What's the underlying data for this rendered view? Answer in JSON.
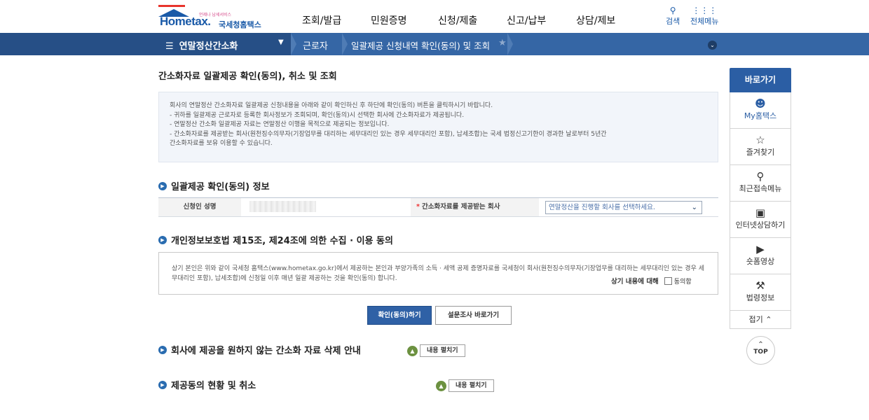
{
  "header": {
    "logo_small": "언제나 납세서비스",
    "logo_brand": "Hometax.",
    "logo_korean": "국세청홈택스",
    "nav": [
      "조회/발급",
      "민원증명",
      "신청/제출",
      "신고/납부",
      "상담/제보"
    ],
    "search_label": "검색",
    "menu_label": "전체메뉴"
  },
  "locbar": {
    "main_menu": "연말정산간소화",
    "crumb1": "근로자",
    "crumb2": "일괄제공 신청내역 확인(동의) 및 조회"
  },
  "page": {
    "title": "간소화자료 일괄제공 확인(동의), 취소 및 조회",
    "info_lines": [
      "회사의 연말정산 간소화자료 일괄제공 신청내용을 아래와 같이 확인하신 후 하단에 확인(동의) 버튼을 클릭하시기 바랍니다.",
      "- 귀하를 일괄제공 근로자로 등록한 회사정보가 조회되며, 확인(동의)시 선택한 회사에 간소화자료가 제공됩니다.",
      "- 연말정산 간소화 일괄제공 자료는 연말정산 이행을 목적으로 제공되는 정보입니다.",
      "- 간소화자료를 제공받는 회사(원천징수의무자(기장업무를 대리하는 세무대리인 있는 경우 세무대리인 포함), 납세조합)는 국세 법정신고기한이 경과한 날로부터 5년간",
      "  간소화자료를 보유 이용할 수 있습니다."
    ],
    "section1_title": "일괄제공 확인(동의) 정보",
    "applicant_label": "신청인 성명",
    "company_label": "간소화자료를 제공받는 회사",
    "company_select": "연말정산을 진행할 회사를 선택하세요.",
    "section2_title": "개인정보보호법 제15조, 제24조에 의한 수집 · 이용 동의",
    "consent_text": "상기 본인은 위와 같이 국세청 홈택스(www.hometax.go.kr)에서 제공하는 본인과 부양가족의 소득 · 세액 공제 증명자료를 국세청이 회사(원천징수의무자(기장업무를 대리하는 세무대리인 있는 경우 세무대리인 포함), 납세조합)에 신청일 이후 매년 일괄 제공하는 것을 확인(동의) 합니다.",
    "agree_label": "상기 내용에 대해",
    "agree_checkbox": "동의함",
    "confirm_button": "확인(동의)하기",
    "survey_button": "설문조사 바로가기",
    "section3_title": "회사에 제공을 원하지 않는 간소화 자료 삭제 안내",
    "section4_title": "제공동의 현황 및 취소",
    "expand_label": "내용 펼치기"
  },
  "quick": {
    "title": "바로가기",
    "items": [
      {
        "label": "My홈택스",
        "icon": "person-icon"
      },
      {
        "label": "즐겨찾기",
        "icon": "star-icon"
      },
      {
        "label": "최근접속메뉴",
        "icon": "recent-search-icon"
      },
      {
        "label": "인터넷상담하기",
        "icon": "monitor-icon"
      },
      {
        "label": "숏폼영상",
        "icon": "play-icon"
      },
      {
        "label": "법령정보",
        "icon": "gavel-icon"
      }
    ],
    "fold": "접기",
    "top": "TOP"
  }
}
